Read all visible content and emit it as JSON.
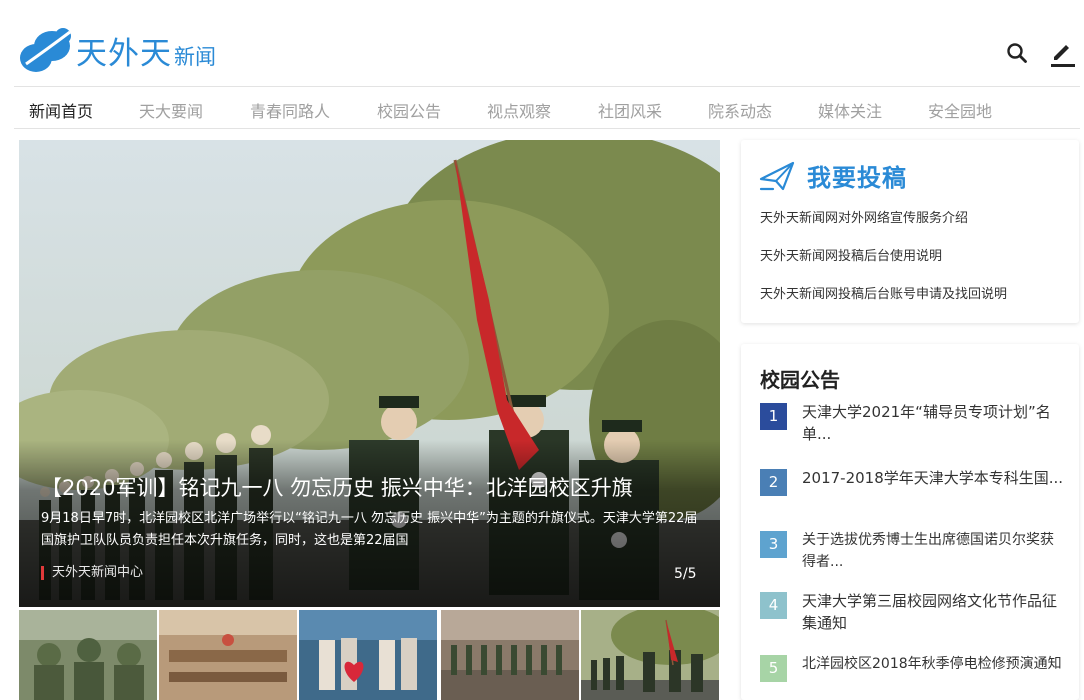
{
  "site": {
    "logo_main": "天外天",
    "logo_sub": "新闻",
    "icons": {
      "search": "search-icon",
      "edit": "edit-pen-icon"
    },
    "accent": "#2a8ad6"
  },
  "nav": {
    "items": [
      {
        "label": "新闻首页",
        "active": true
      },
      {
        "label": "天大要闻"
      },
      {
        "label": "青春同路人"
      },
      {
        "label": "校园公告"
      },
      {
        "label": "视点观察"
      },
      {
        "label": "社团风采"
      },
      {
        "label": "院系动态"
      },
      {
        "label": "媒体关注"
      },
      {
        "label": "安全园地"
      }
    ]
  },
  "hero": {
    "title": "【2020军训】铭记九一八 勿忘历史 振兴中华：北洋园校区升旗",
    "description": "9月18日早7时，北洋园校区北洋广场举行以“铭记九一八 勿忘历史 振兴中华”为主题的升旗仪式。天津大学第22届国旗护卫队队员负责担任本次升旗任务，同时，这也是第22届国",
    "source": "天外天新闻中心",
    "counter": "5/5"
  },
  "submit": {
    "title": "我要投稿",
    "icon": "paper-plane-icon",
    "links": [
      "天外天新闻网对外网络宣传服务介绍",
      "天外天新闻网投稿后台使用说明",
      "天外天新闻网投稿后台账号申请及找回说明"
    ]
  },
  "notices": {
    "title": "校园公告",
    "items": [
      {
        "num": "1",
        "text": "天津大学2021年“辅导员专项计划”名单...",
        "color": "#2b4c9c"
      },
      {
        "num": "2",
        "text": "2017-2018学年天津大学本专科生国...",
        "color": "#4a7fb5"
      },
      {
        "num": "3",
        "text": "关于选拔优秀博士生出席德国诺贝尔奖获得者...",
        "color": "#5ea3cf"
      },
      {
        "num": "4",
        "text": "天津大学第三届校园网络文化节作品征集通知",
        "color": "#8ec2cc"
      },
      {
        "num": "5",
        "text": "北洋园校区2018年秋季停电检修预演通知",
        "color": "#a7d4a6"
      }
    ]
  }
}
